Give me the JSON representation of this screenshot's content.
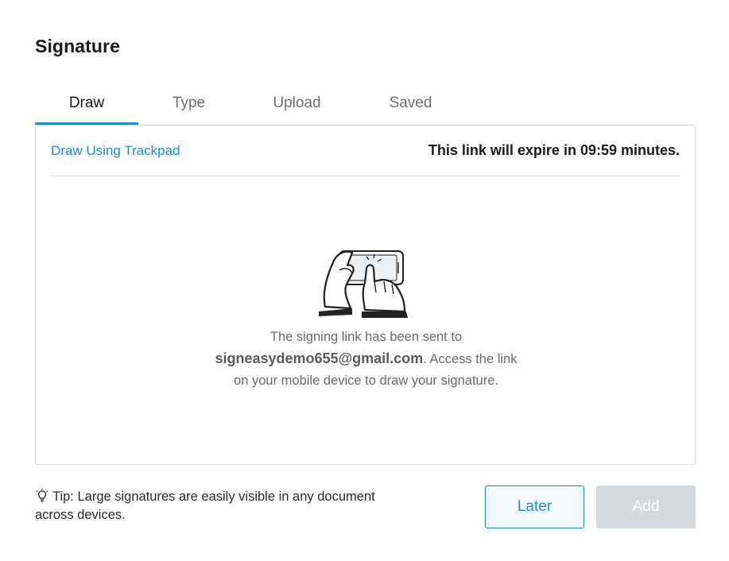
{
  "dialog": {
    "title": "Signature"
  },
  "tabs": [
    {
      "label": "Draw",
      "active": true
    },
    {
      "label": "Type",
      "active": false
    },
    {
      "label": "Upload",
      "active": false
    },
    {
      "label": "Saved",
      "active": false
    }
  ],
  "panel": {
    "link_label": "Draw Using Trackpad",
    "expire_text": "This link will expire in 09:59 minutes.",
    "illustration_icon": "hands-holding-phone-icon",
    "message_prefix": "The signing link has been sent to",
    "email": "signeasydemo655@gmail.com",
    "message_suffix_1": ". Access the link",
    "message_suffix_2": "on your mobile device to draw your signature."
  },
  "footer": {
    "tip_icon": "lightbulb-icon",
    "tip_line_1": "Tip: Large signatures are easily visible in any document",
    "tip_line_2": "across devices.",
    "later_label": "Later",
    "add_label": "Add"
  },
  "colors": {
    "accent": "#1a8fd0",
    "disabled_button": "#d5d8dc",
    "border": "#dcdcdc"
  }
}
